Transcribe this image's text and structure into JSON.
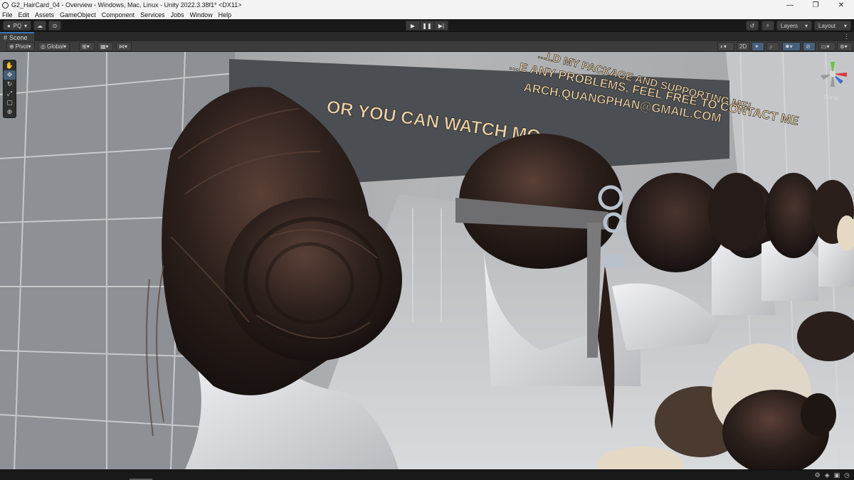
{
  "window": {
    "title": "G2_HairCard_04 - Overview - Windows, Mac, Linux - Unity 2022.3.38f1* <DX11>",
    "controls": [
      "—",
      "❐",
      "✕"
    ]
  },
  "menu": [
    "File",
    "Edit",
    "Assets",
    "GameObject",
    "Component",
    "Services",
    "Jobs",
    "Window",
    "Help"
  ],
  "toolbar": {
    "account_label": "PQ",
    "layers_label": "Layers",
    "layout_label": "Layout"
  },
  "scene_tab": {
    "label": "Scene"
  },
  "scene_toolbar": {
    "pivot_label": "Pivot",
    "global_label": "Global",
    "mode_2d_label": "2D"
  },
  "gizmo": {
    "projection_label": "Persp"
  },
  "sign_text": {
    "line1": "...LD MY PACKAGE AND SUPPORTING ME!",
    "line2": "...E ANY PROBLEMS, FEEL FREE TO CONTACT ME",
    "line3": "ARCH.QUANGPHAN@GMAIL.COM",
    "line4": "OR YOU CAN WATCH MO..."
  },
  "colors": {
    "accent": "#3a79bb",
    "toolbar_bg": "#191919",
    "scene_toolbar_bg": "#3c3c3c"
  }
}
